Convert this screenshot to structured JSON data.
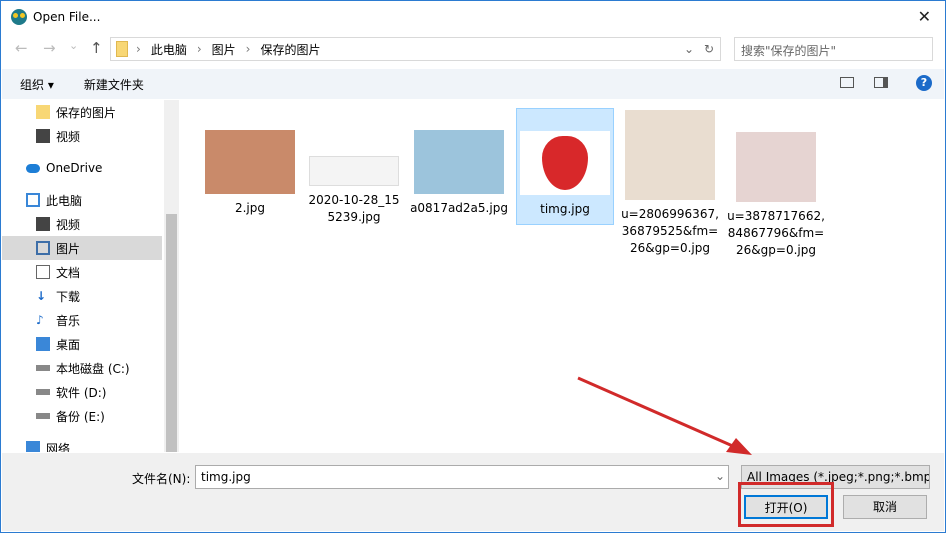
{
  "window": {
    "title": "Open File...",
    "close": "✕"
  },
  "nav": {
    "back": "←",
    "forward": "→",
    "recent": "⌄",
    "up": "↑",
    "breadcrumb": [
      "此电脑",
      "图片",
      "保存的图片"
    ],
    "search_placeholder": "搜索\"保存的图片\""
  },
  "toolbar": {
    "organize": "组织 ▾",
    "new_folder": "新建文件夹",
    "help": "?"
  },
  "sidebar": {
    "items": [
      "保存的图片",
      "视频",
      "OneDrive",
      "此电脑",
      "视频",
      "图片",
      "文档",
      "下载",
      "音乐",
      "桌面",
      "本地磁盘 (C:)",
      "软件 (D:)",
      "备份 (E:)",
      "网络"
    ]
  },
  "files": [
    {
      "name": "2.jpg",
      "color": "#c98a6a"
    },
    {
      "name": "2020-10-28_155239.jpg",
      "color": "#f4f4f4"
    },
    {
      "name": "a0817ad2a5.jpg",
      "color": "#9cc4dc"
    },
    {
      "name": "timg.jpg",
      "color": "#d8282a"
    },
    {
      "name": "u=2806996367,36879525&fm=26&gp=0.jpg",
      "color": "#e9ddd0"
    },
    {
      "name": "u=3878717662,84867796&fm=26&gp=0.jpg",
      "color": "#e6d4d2"
    }
  ],
  "bottom": {
    "filename_label": "文件名(N):",
    "filename_value": "timg.jpg",
    "filetype": "All Images (*.jpeg;*.png;*.bmp",
    "open": "打开(O)",
    "cancel": "取消"
  }
}
